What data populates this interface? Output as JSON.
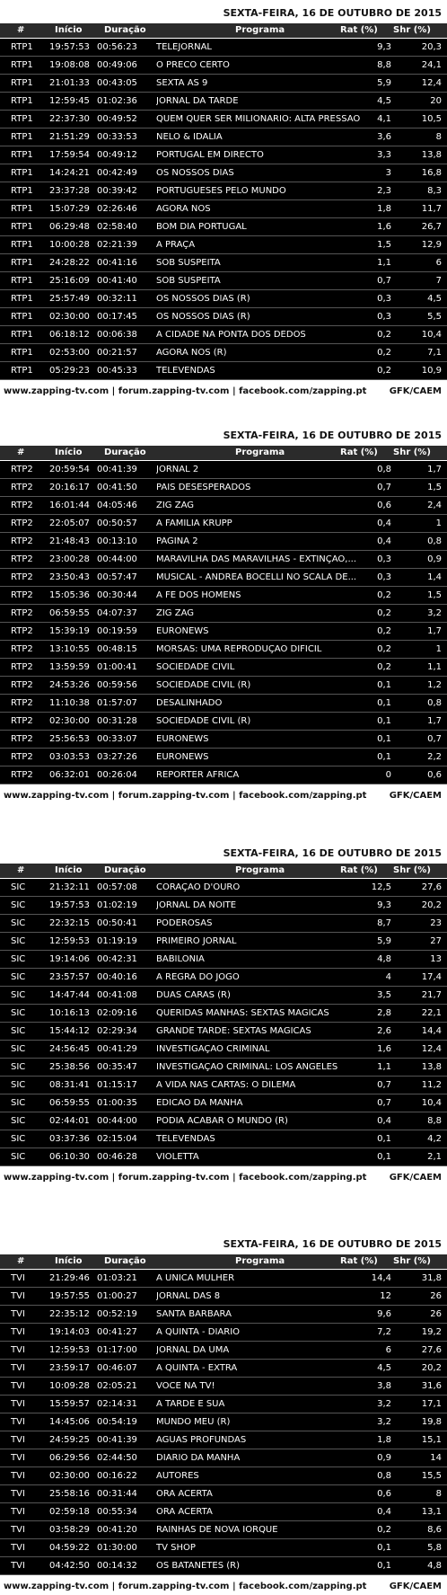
{
  "footer": {
    "links": "www.zapping-tv.com | forum.zapping-tv.com | facebook.com/zapping.pt",
    "source": "GFK/CAEM"
  },
  "columns": {
    "channel": "#",
    "start": "Início",
    "duration": "Duração",
    "program": "Programa",
    "rating": "Rat (%)",
    "share": "Shr (%)"
  },
  "sections": [
    {
      "date": "SEXTA-FEIRA, 16 DE OUTUBRO DE 2015",
      "rows": [
        [
          "RTP1",
          "19:57:53",
          "00:56:23",
          "TELEJORNAL",
          "9,3",
          "20,3"
        ],
        [
          "RTP1",
          "19:08:08",
          "00:49:06",
          "O PRECO CERTO",
          "8,8",
          "24,1"
        ],
        [
          "RTP1",
          "21:01:33",
          "00:43:05",
          "SEXTA AS 9",
          "5,9",
          "12,4"
        ],
        [
          "RTP1",
          "12:59:45",
          "01:02:36",
          "JORNAL DA TARDE",
          "4,5",
          "20"
        ],
        [
          "RTP1",
          "22:37:30",
          "00:49:52",
          "QUEM QUER SER MILIONARIO: ALTA PRESSAO",
          "4,1",
          "10,5"
        ],
        [
          "RTP1",
          "21:51:29",
          "00:33:53",
          "NELO & IDALIA",
          "3,6",
          "8"
        ],
        [
          "RTP1",
          "17:59:54",
          "00:49:12",
          "PORTUGAL EM DIRECTO",
          "3,3",
          "13,8"
        ],
        [
          "RTP1",
          "14:24:21",
          "00:42:49",
          "OS NOSSOS DIAS",
          "3",
          "16,8"
        ],
        [
          "RTP1",
          "23:37:28",
          "00:39:42",
          "PORTUGUESES PELO MUNDO",
          "2,3",
          "8,3"
        ],
        [
          "RTP1",
          "15:07:29",
          "02:26:46",
          "AGORA NOS",
          "1,8",
          "11,7"
        ],
        [
          "RTP1",
          "06:29:48",
          "02:58:40",
          "BOM DIA PORTUGAL",
          "1,6",
          "26,7"
        ],
        [
          "RTP1",
          "10:00:28",
          "02:21:39",
          "A PRAÇA",
          "1,5",
          "12,9"
        ],
        [
          "RTP1",
          "24:28:22",
          "00:41:16",
          "SOB SUSPEITA",
          "1,1",
          "6"
        ],
        [
          "RTP1",
          "25:16:09",
          "00:41:40",
          "SOB SUSPEITA",
          "0,7",
          "7"
        ],
        [
          "RTP1",
          "25:57:49",
          "00:32:11",
          "OS NOSSOS DIAS (R)",
          "0,3",
          "4,5"
        ],
        [
          "RTP1",
          "02:30:00",
          "00:17:45",
          "OS NOSSOS DIAS (R)",
          "0,3",
          "5,5"
        ],
        [
          "RTP1",
          "06:18:12",
          "00:06:38",
          "A CIDADE NA PONTA DOS DEDOS",
          "0,2",
          "10,4"
        ],
        [
          "RTP1",
          "02:53:00",
          "00:21:57",
          "AGORA NOS (R)",
          "0,2",
          "7,1"
        ],
        [
          "RTP1",
          "05:29:23",
          "00:45:33",
          "TELEVENDAS",
          "0,2",
          "10,9"
        ]
      ]
    },
    {
      "date": "SEXTA-FEIRA, 16 DE OUTUBRO DE 2015",
      "rows": [
        [
          "RTP2",
          "20:59:54",
          "00:41:39",
          "JORNAL 2",
          "0,8",
          "1,7"
        ],
        [
          "RTP2",
          "20:16:17",
          "00:41:50",
          "PAIS DESESPERADOS",
          "0,7",
          "1,5"
        ],
        [
          "RTP2",
          "16:01:44",
          "04:05:46",
          "ZIG ZAG",
          "0,6",
          "2,4"
        ],
        [
          "RTP2",
          "22:05:07",
          "00:50:57",
          "A FAMILIA KRUPP",
          "0,4",
          "1"
        ],
        [
          "RTP2",
          "21:48:43",
          "00:13:10",
          "PAGINA 2",
          "0,4",
          "0,8"
        ],
        [
          "RTP2",
          "23:00:28",
          "00:44:00",
          "MARAVILHA DAS MARAVILHAS - EXTINÇAO,...",
          "0,3",
          "0,9"
        ],
        [
          "RTP2",
          "23:50:43",
          "00:57:47",
          "MUSICAL - ANDREA BOCELLI NO SCALA DE...",
          "0,3",
          "1,4"
        ],
        [
          "RTP2",
          "15:05:36",
          "00:30:44",
          "A FE DOS HOMENS",
          "0,2",
          "1,5"
        ],
        [
          "RTP2",
          "06:59:55",
          "04:07:37",
          "ZIG ZAG",
          "0,2",
          "3,2"
        ],
        [
          "RTP2",
          "15:39:19",
          "00:19:59",
          "EURONEWS",
          "0,2",
          "1,7"
        ],
        [
          "RTP2",
          "13:10:55",
          "00:48:15",
          "MORSAS: UMA REPRODUÇAO DIFICIL",
          "0,2",
          "1"
        ],
        [
          "RTP2",
          "13:59:59",
          "01:00:41",
          "SOCIEDADE CIVIL",
          "0,2",
          "1,1"
        ],
        [
          "RTP2",
          "24:53:26",
          "00:59:56",
          "SOCIEDADE CIVIL (R)",
          "0,1",
          "1,2"
        ],
        [
          "RTP2",
          "11:10:38",
          "01:57:07",
          "DESALINHADO",
          "0,1",
          "0,8"
        ],
        [
          "RTP2",
          "02:30:00",
          "00:31:28",
          "SOCIEDADE CIVIL (R)",
          "0,1",
          "1,7"
        ],
        [
          "RTP2",
          "25:56:53",
          "00:33:07",
          "EURONEWS",
          "0,1",
          "0,7"
        ],
        [
          "RTP2",
          "03:03:53",
          "03:27:26",
          "EURONEWS",
          "0,1",
          "2,2"
        ],
        [
          "RTP2",
          "06:32:01",
          "00:26:04",
          "REPORTER AFRICA",
          "0",
          "0,6"
        ]
      ]
    },
    {
      "date": "SEXTA-FEIRA, 16 DE OUTUBRO DE 2015",
      "rows": [
        [
          "SIC",
          "21:32:11",
          "00:57:08",
          "CORAÇAO D'OURO",
          "12,5",
          "27,6"
        ],
        [
          "SIC",
          "19:57:53",
          "01:02:19",
          "JORNAL DA NOITE",
          "9,3",
          "20,2"
        ],
        [
          "SIC",
          "22:32:15",
          "00:50:41",
          "PODEROSAS",
          "8,7",
          "23"
        ],
        [
          "SIC",
          "12:59:53",
          "01:19:19",
          "PRIMEIRO JORNAL",
          "5,9",
          "27"
        ],
        [
          "SIC",
          "19:14:06",
          "00:42:31",
          "BABILONIA",
          "4,8",
          "13"
        ],
        [
          "SIC",
          "23:57:57",
          "00:40:16",
          "A REGRA DO JOGO",
          "4",
          "17,4"
        ],
        [
          "SIC",
          "14:47:44",
          "00:41:08",
          "DUAS CARAS (R)",
          "3,5",
          "21,7"
        ],
        [
          "SIC",
          "10:16:13",
          "02:09:16",
          "QUERIDAS MANHAS: SEXTAS MAGICAS",
          "2,8",
          "22,1"
        ],
        [
          "SIC",
          "15:44:12",
          "02:29:34",
          "GRANDE TARDE: SEXTAS MAGICAS",
          "2,6",
          "14,4"
        ],
        [
          "SIC",
          "24:56:45",
          "00:41:29",
          "INVESTIGAÇAO CRIMINAL",
          "1,6",
          "12,4"
        ],
        [
          "SIC",
          "25:38:56",
          "00:35:47",
          "INVESTIGAÇAO CRIMINAL: LOS ANGELES",
          "1,1",
          "13,8"
        ],
        [
          "SIC",
          "08:31:41",
          "01:15:17",
          "A VIDA NAS CARTAS: O DILEMA",
          "0,7",
          "11,2"
        ],
        [
          "SIC",
          "06:59:55",
          "01:00:35",
          "EDICAO DA MANHA",
          "0,7",
          "10,4"
        ],
        [
          "SIC",
          "02:44:01",
          "00:44:00",
          "PODIA ACABAR O MUNDO (R)",
          "0,4",
          "8,8"
        ],
        [
          "SIC",
          "03:37:36",
          "02:15:04",
          "TELEVENDAS",
          "0,1",
          "4,2"
        ],
        [
          "SIC",
          "06:10:30",
          "00:46:28",
          "VIOLETTA",
          "0,1",
          "2,1"
        ]
      ]
    },
    {
      "date": "SEXTA-FEIRA, 16 DE OUTUBRO DE 2015",
      "rows": [
        [
          "TVI",
          "21:29:46",
          "01:03:21",
          "A UNICA MULHER",
          "14,4",
          "31,8"
        ],
        [
          "TVI",
          "19:57:55",
          "01:00:27",
          "JORNAL DAS 8",
          "12",
          "26"
        ],
        [
          "TVI",
          "22:35:12",
          "00:52:19",
          "SANTA BARBARA",
          "9,6",
          "26"
        ],
        [
          "TVI",
          "19:14:03",
          "00:41:27",
          "A QUINTA - DIARIO",
          "7,2",
          "19,2"
        ],
        [
          "TVI",
          "12:59:53",
          "01:17:00",
          "JORNAL DA UMA",
          "6",
          "27,6"
        ],
        [
          "TVI",
          "23:59:17",
          "00:46:07",
          "A QUINTA - EXTRA",
          "4,5",
          "20,2"
        ],
        [
          "TVI",
          "10:09:28",
          "02:05:21",
          "VOCE NA TV!",
          "3,8",
          "31,6"
        ],
        [
          "TVI",
          "15:59:57",
          "02:14:31",
          "A TARDE E SUA",
          "3,2",
          "17,1"
        ],
        [
          "TVI",
          "14:45:06",
          "00:54:19",
          "MUNDO MEU (R)",
          "3,2",
          "19,8"
        ],
        [
          "TVI",
          "24:59:25",
          "00:41:39",
          "AGUAS PROFUNDAS",
          "1,8",
          "15,1"
        ],
        [
          "TVI",
          "06:29:56",
          "02:44:50",
          "DIARIO DA MANHA",
          "0,9",
          "14"
        ],
        [
          "TVI",
          "02:30:00",
          "00:16:22",
          "AUTORES",
          "0,8",
          "15,5"
        ],
        [
          "TVI",
          "25:58:16",
          "00:31:44",
          "ORA ACERTA",
          "0,6",
          "8"
        ],
        [
          "TVI",
          "02:59:18",
          "00:55:34",
          "ORA ACERTA",
          "0,4",
          "13,1"
        ],
        [
          "TVI",
          "03:58:29",
          "00:41:20",
          "RAINHAS DE NOVA IORQUE",
          "0,2",
          "8,6"
        ],
        [
          "TVI",
          "04:59:22",
          "01:30:00",
          "TV SHOP",
          "0,1",
          "5,8"
        ],
        [
          "TVI",
          "04:42:50",
          "00:14:32",
          "OS BATANETES (R)",
          "0,1",
          "4,8"
        ]
      ]
    }
  ]
}
